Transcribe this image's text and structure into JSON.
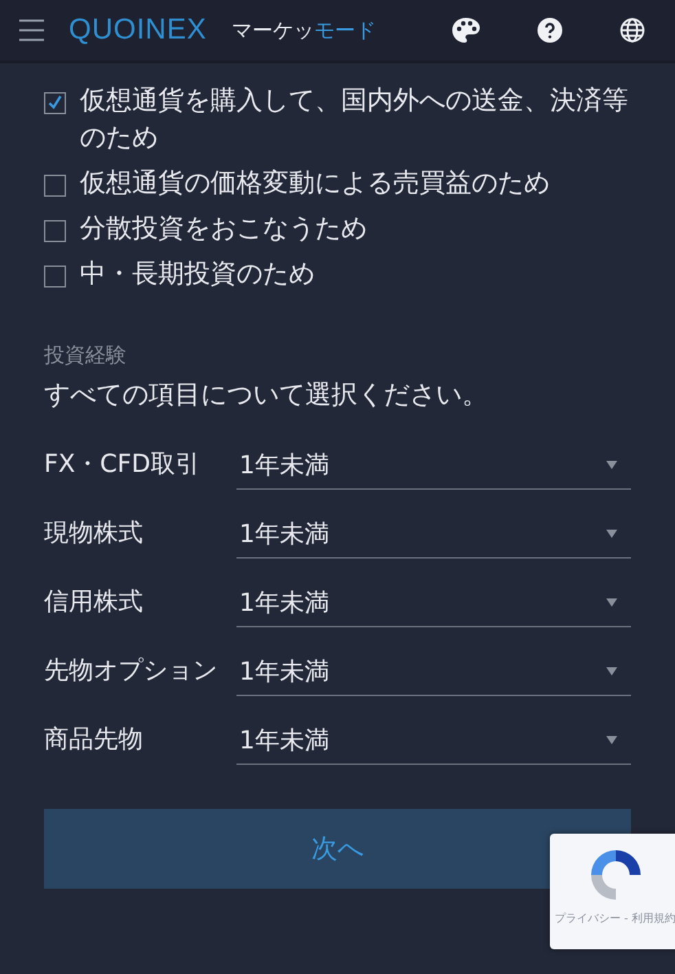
{
  "header": {
    "logo": "QUOINEX",
    "mode_label": [
      {
        "text": "マーケッ",
        "kind": "plain"
      },
      {
        "text": "モード",
        "kind": "accent"
      }
    ]
  },
  "purposes": [
    {
      "label": "仮想通貨を購入して、国内外への送金、決済等のため",
      "checked": true
    },
    {
      "label": "仮想通貨の価格変動による売買益のため",
      "checked": false
    },
    {
      "label": "分散投資をおこなうため",
      "checked": false
    },
    {
      "label": "中・長期投資のため",
      "checked": false
    }
  ],
  "experience": {
    "heading": "投資経験",
    "instruction": "すべての項目について選択ください。",
    "rows": [
      {
        "label": "FX・CFD取引",
        "value": "1年未満"
      },
      {
        "label": "現物株式",
        "value": "1年未満"
      },
      {
        "label": "信用株式",
        "value": "1年未満"
      },
      {
        "label": "先物オプション",
        "value": "1年未満"
      },
      {
        "label": "商品先物",
        "value": "1年未満"
      }
    ]
  },
  "next_button": "次へ",
  "recaptcha": {
    "links": "プライバシー - 利用規約"
  }
}
